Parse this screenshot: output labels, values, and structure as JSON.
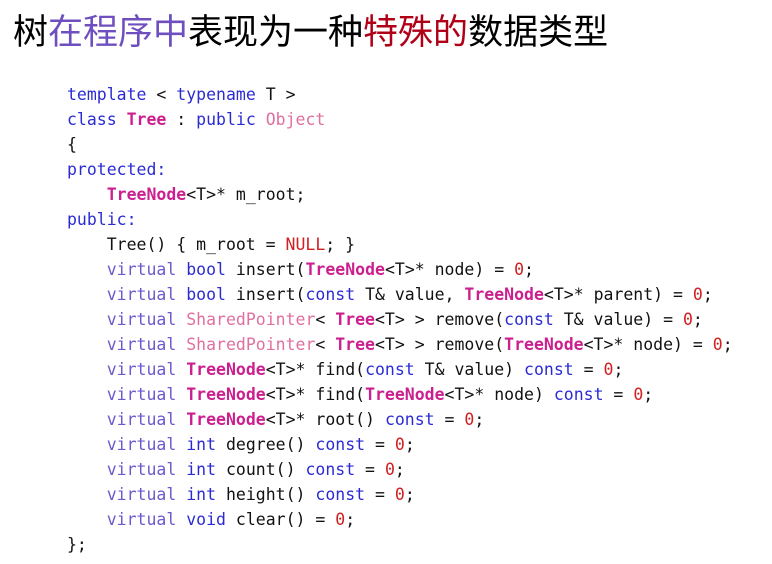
{
  "slide": {
    "title_segments": [
      {
        "text": "树",
        "color": "#000000"
      },
      {
        "text": "在程序中",
        "color": "#6f4fbf"
      },
      {
        "text": "表现为一种",
        "color": "#000000"
      },
      {
        "text": "特殊的",
        "color": "#b00018"
      },
      {
        "text": "数据类型",
        "color": "#000000"
      }
    ],
    "title_plain": "树在程序中表现为一种特殊的数据类型",
    "background_color": "#ffffff"
  },
  "colors": {
    "keyword": "#2b2bd4",
    "virtual": "#6a5acd",
    "type_bold": "#cc1f8f",
    "type_light": "#e0709f",
    "number": "#d02020",
    "plain": "#111111",
    "title_purple": "#6f4fbf",
    "title_red": "#b00018"
  },
  "code": {
    "language": "cpp",
    "plain_text": "template < typename T >\nclass Tree : public Object\n{\nprotected:\n    TreeNode<T>* m_root;\npublic:\n    Tree() { m_root = NULL; }\n    virtual bool insert(TreeNode<T>* node) = 0;\n    virtual bool insert(const T& value, TreeNode<T>* parent) = 0;\n    virtual SharedPointer< Tree<T> > remove(const T& value) = 0;\n    virtual SharedPointer< Tree<T> > remove(TreeNode<T>* node) = 0;\n    virtual TreeNode<T>* find(const T& value) const = 0;\n    virtual TreeNode<T>* find(TreeNode<T>* node) const = 0;\n    virtual TreeNode<T>* root() const = 0;\n    virtual int degree() const = 0;\n    virtual int count() const = 0;\n    virtual int height() const = 0;\n    virtual void clear() = 0;\n};",
    "lines": [
      {
        "n": 1,
        "tokens": [
          {
            "t": "template",
            "c": "kw"
          },
          {
            "t": " < ",
            "c": "plain"
          },
          {
            "t": "typename",
            "c": "kw"
          },
          {
            "t": " T >",
            "c": "plain"
          }
        ]
      },
      {
        "n": 2,
        "tokens": [
          {
            "t": "class",
            "c": "kw"
          },
          {
            "t": " ",
            "c": "plain"
          },
          {
            "t": "Tree",
            "c": "type"
          },
          {
            "t": " : ",
            "c": "plain"
          },
          {
            "t": "public",
            "c": "kw"
          },
          {
            "t": " ",
            "c": "plain"
          },
          {
            "t": "Object",
            "c": "type2"
          }
        ]
      },
      {
        "n": 3,
        "tokens": [
          {
            "t": "{",
            "c": "plain"
          }
        ]
      },
      {
        "n": 4,
        "tokens": [
          {
            "t": "protected:",
            "c": "kw"
          }
        ]
      },
      {
        "n": 5,
        "tokens": [
          {
            "t": "    ",
            "c": "plain"
          },
          {
            "t": "TreeNode",
            "c": "type"
          },
          {
            "t": "<T>* m_root;",
            "c": "plain"
          }
        ]
      },
      {
        "n": 6,
        "tokens": [
          {
            "t": "public:",
            "c": "kw"
          }
        ]
      },
      {
        "n": 7,
        "tokens": [
          {
            "t": "    Tree() { m_root = ",
            "c": "plain"
          },
          {
            "t": "NULL",
            "c": "num"
          },
          {
            "t": "; }",
            "c": "plain"
          }
        ]
      },
      {
        "n": 8,
        "tokens": [
          {
            "t": "    ",
            "c": "plain"
          },
          {
            "t": "virtual",
            "c": "virt"
          },
          {
            "t": " ",
            "c": "plain"
          },
          {
            "t": "bool",
            "c": "kw"
          },
          {
            "t": " insert(",
            "c": "plain"
          },
          {
            "t": "TreeNode",
            "c": "type"
          },
          {
            "t": "<T>* node) = ",
            "c": "plain"
          },
          {
            "t": "0",
            "c": "num"
          },
          {
            "t": ";",
            "c": "plain"
          }
        ]
      },
      {
        "n": 9,
        "tokens": [
          {
            "t": "    ",
            "c": "plain"
          },
          {
            "t": "virtual",
            "c": "virt"
          },
          {
            "t": " ",
            "c": "plain"
          },
          {
            "t": "bool",
            "c": "kw"
          },
          {
            "t": " insert(",
            "c": "plain"
          },
          {
            "t": "const",
            "c": "kw"
          },
          {
            "t": " T& value, ",
            "c": "plain"
          },
          {
            "t": "TreeNode",
            "c": "type"
          },
          {
            "t": "<T>* parent) = ",
            "c": "plain"
          },
          {
            "t": "0",
            "c": "num"
          },
          {
            "t": ";",
            "c": "plain"
          }
        ]
      },
      {
        "n": 10,
        "tokens": [
          {
            "t": "    ",
            "c": "plain"
          },
          {
            "t": "virtual",
            "c": "virt"
          },
          {
            "t": " ",
            "c": "plain"
          },
          {
            "t": "SharedPointer",
            "c": "type2"
          },
          {
            "t": "< ",
            "c": "plain"
          },
          {
            "t": "Tree",
            "c": "type"
          },
          {
            "t": "<T> > remove(",
            "c": "plain"
          },
          {
            "t": "const",
            "c": "kw"
          },
          {
            "t": " T& value) = ",
            "c": "plain"
          },
          {
            "t": "0",
            "c": "num"
          },
          {
            "t": ";",
            "c": "plain"
          }
        ]
      },
      {
        "n": 11,
        "tokens": [
          {
            "t": "    ",
            "c": "plain"
          },
          {
            "t": "virtual",
            "c": "virt"
          },
          {
            "t": " ",
            "c": "plain"
          },
          {
            "t": "SharedPointer",
            "c": "type2"
          },
          {
            "t": "< ",
            "c": "plain"
          },
          {
            "t": "Tree",
            "c": "type"
          },
          {
            "t": "<T> > remove(",
            "c": "plain"
          },
          {
            "t": "TreeNode",
            "c": "type"
          },
          {
            "t": "<T>* node) = ",
            "c": "plain"
          },
          {
            "t": "0",
            "c": "num"
          },
          {
            "t": ";",
            "c": "plain"
          }
        ]
      },
      {
        "n": 12,
        "tokens": [
          {
            "t": "    ",
            "c": "plain"
          },
          {
            "t": "virtual",
            "c": "virt"
          },
          {
            "t": " ",
            "c": "plain"
          },
          {
            "t": "TreeNode",
            "c": "type"
          },
          {
            "t": "<T>* find(",
            "c": "plain"
          },
          {
            "t": "const",
            "c": "kw"
          },
          {
            "t": " T& value) ",
            "c": "plain"
          },
          {
            "t": "const",
            "c": "kw"
          },
          {
            "t": " = ",
            "c": "plain"
          },
          {
            "t": "0",
            "c": "num"
          },
          {
            "t": ";",
            "c": "plain"
          }
        ]
      },
      {
        "n": 13,
        "tokens": [
          {
            "t": "    ",
            "c": "plain"
          },
          {
            "t": "virtual",
            "c": "virt"
          },
          {
            "t": " ",
            "c": "plain"
          },
          {
            "t": "TreeNode",
            "c": "type"
          },
          {
            "t": "<T>* find(",
            "c": "plain"
          },
          {
            "t": "TreeNode",
            "c": "type"
          },
          {
            "t": "<T>* node) ",
            "c": "plain"
          },
          {
            "t": "const",
            "c": "kw"
          },
          {
            "t": " = ",
            "c": "plain"
          },
          {
            "t": "0",
            "c": "num"
          },
          {
            "t": ";",
            "c": "plain"
          }
        ]
      },
      {
        "n": 14,
        "tokens": [
          {
            "t": "    ",
            "c": "plain"
          },
          {
            "t": "virtual",
            "c": "virt"
          },
          {
            "t": " ",
            "c": "plain"
          },
          {
            "t": "TreeNode",
            "c": "type"
          },
          {
            "t": "<T>* root() ",
            "c": "plain"
          },
          {
            "t": "const",
            "c": "kw"
          },
          {
            "t": " = ",
            "c": "plain"
          },
          {
            "t": "0",
            "c": "num"
          },
          {
            "t": ";",
            "c": "plain"
          }
        ]
      },
      {
        "n": 15,
        "tokens": [
          {
            "t": "    ",
            "c": "plain"
          },
          {
            "t": "virtual",
            "c": "virt"
          },
          {
            "t": " ",
            "c": "plain"
          },
          {
            "t": "int",
            "c": "kw"
          },
          {
            "t": " degree() ",
            "c": "plain"
          },
          {
            "t": "const",
            "c": "kw"
          },
          {
            "t": " = ",
            "c": "plain"
          },
          {
            "t": "0",
            "c": "num"
          },
          {
            "t": ";",
            "c": "plain"
          }
        ]
      },
      {
        "n": 16,
        "tokens": [
          {
            "t": "    ",
            "c": "plain"
          },
          {
            "t": "virtual",
            "c": "virt"
          },
          {
            "t": " ",
            "c": "plain"
          },
          {
            "t": "int",
            "c": "kw"
          },
          {
            "t": " count() ",
            "c": "plain"
          },
          {
            "t": "const",
            "c": "kw"
          },
          {
            "t": " = ",
            "c": "plain"
          },
          {
            "t": "0",
            "c": "num"
          },
          {
            "t": ";",
            "c": "plain"
          }
        ]
      },
      {
        "n": 17,
        "tokens": [
          {
            "t": "    ",
            "c": "plain"
          },
          {
            "t": "virtual",
            "c": "virt"
          },
          {
            "t": " ",
            "c": "plain"
          },
          {
            "t": "int",
            "c": "kw"
          },
          {
            "t": " height() ",
            "c": "plain"
          },
          {
            "t": "const",
            "c": "kw"
          },
          {
            "t": " = ",
            "c": "plain"
          },
          {
            "t": "0",
            "c": "num"
          },
          {
            "t": ";",
            "c": "plain"
          }
        ]
      },
      {
        "n": 18,
        "tokens": [
          {
            "t": "    ",
            "c": "plain"
          },
          {
            "t": "virtual",
            "c": "virt"
          },
          {
            "t": " ",
            "c": "plain"
          },
          {
            "t": "void",
            "c": "kw"
          },
          {
            "t": " clear() = ",
            "c": "plain"
          },
          {
            "t": "0",
            "c": "num"
          },
          {
            "t": ";",
            "c": "plain"
          }
        ]
      },
      {
        "n": 19,
        "tokens": [
          {
            "t": "};",
            "c": "plain"
          }
        ]
      }
    ]
  }
}
